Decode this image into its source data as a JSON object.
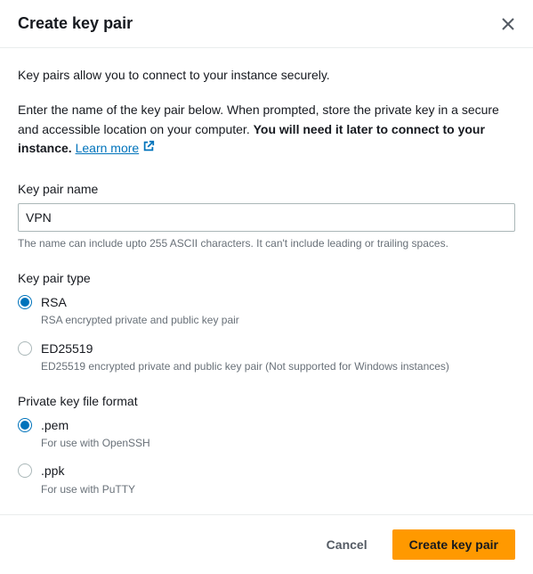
{
  "header": {
    "title": "Create key pair"
  },
  "intro": "Key pairs allow you to connect to your instance securely.",
  "descPrefix": "Enter the name of the key pair below. When prompted, store the private key in a secure and accessible location on your computer. ",
  "descBold": "You will need it later to connect to your instance.",
  "learnMore": "Learn more",
  "keyPairName": {
    "label": "Key pair name",
    "value": "VPN",
    "helper": "The name can include upto 255 ASCII characters. It can't include leading or trailing spaces."
  },
  "keyPairType": {
    "label": "Key pair type",
    "options": [
      {
        "label": "RSA",
        "desc": "RSA encrypted private and public key pair",
        "selected": true
      },
      {
        "label": "ED25519",
        "desc": "ED25519 encrypted private and public key pair (Not supported for Windows instances)",
        "selected": false
      }
    ]
  },
  "fileFormat": {
    "label": "Private key file format",
    "options": [
      {
        "label": ".pem",
        "desc": "For use with OpenSSH",
        "selected": true
      },
      {
        "label": ".ppk",
        "desc": "For use with PuTTY",
        "selected": false
      }
    ]
  },
  "footer": {
    "cancel": "Cancel",
    "create": "Create key pair"
  }
}
